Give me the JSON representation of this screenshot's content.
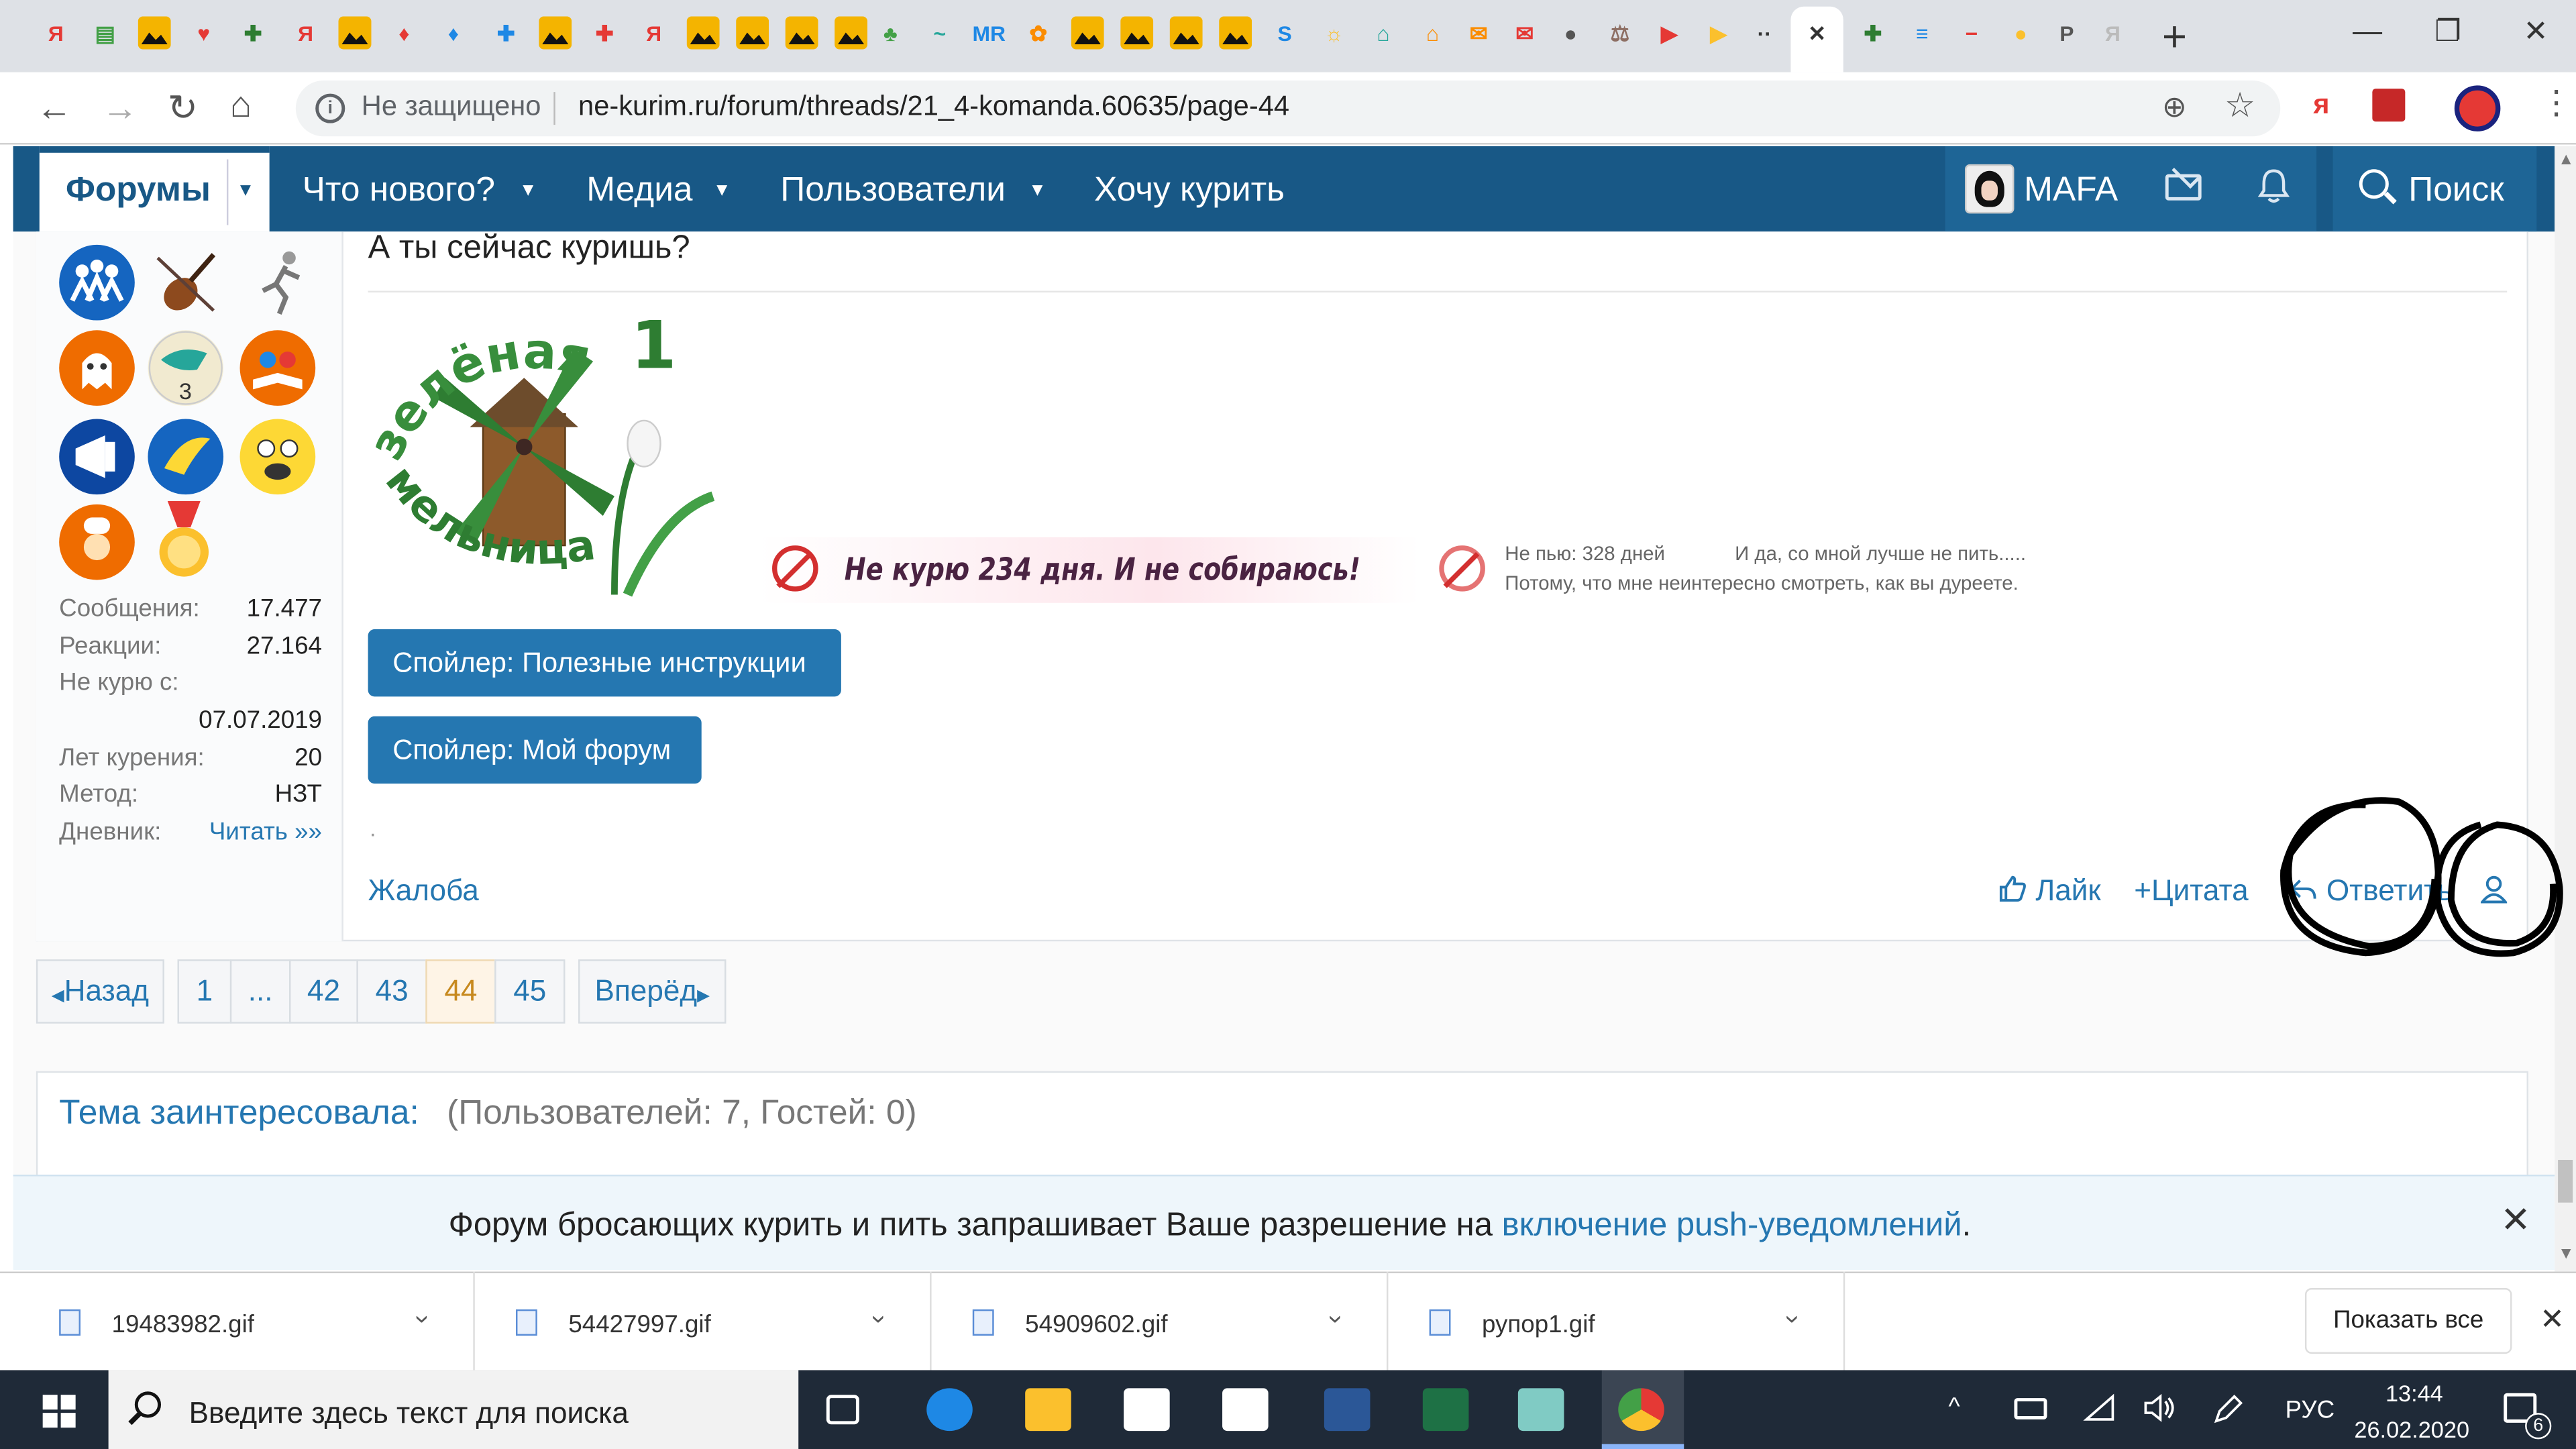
{
  "browser": {
    "tabs": [
      {
        "icon": "yandex-icon",
        "glyph": "Я",
        "color": "#e53935"
      },
      {
        "icon": "cart-icon",
        "glyph": "▤",
        "color": "#43a047"
      },
      {
        "icon": "image-icon",
        "glyph": "",
        "color": "#f4b400"
      },
      {
        "icon": "heart-icon",
        "glyph": "♥",
        "color": "#e53935"
      },
      {
        "icon": "plus-icon",
        "glyph": "✚",
        "color": "#2e7d32"
      },
      {
        "icon": "yandex-icon",
        "glyph": "Я",
        "color": "#e53935"
      },
      {
        "icon": "image-icon",
        "glyph": "",
        "color": "#f4b400"
      },
      {
        "icon": "map-pin-icon",
        "glyph": "♦",
        "color": "#e53935"
      },
      {
        "icon": "maps-icon",
        "glyph": "♦",
        "color": "#1e88e5"
      },
      {
        "icon": "cross-icon",
        "glyph": "✚",
        "color": "#1e88e5"
      },
      {
        "icon": "image-icon",
        "glyph": "",
        "color": "#f4b400"
      },
      {
        "icon": "medical-cross-icon",
        "glyph": "✚",
        "color": "#e53935"
      },
      {
        "icon": "yandex-icon",
        "glyph": "Я",
        "color": "#e53935"
      },
      {
        "icon": "image-icon",
        "glyph": "",
        "color": "#f4b400"
      },
      {
        "icon": "image-icon",
        "glyph": "",
        "color": "#f4b400"
      },
      {
        "icon": "image-icon",
        "glyph": "",
        "color": "#f4b400"
      },
      {
        "icon": "image-icon",
        "glyph": "",
        "color": "#f4b400"
      },
      {
        "icon": "flask-icon",
        "glyph": "♣",
        "color": "#43a047"
      },
      {
        "icon": "leaf-icon",
        "glyph": "~",
        "color": "#26a69a"
      },
      {
        "icon": "mr-icon",
        "glyph": "MR",
        "color": "#1e88e5"
      },
      {
        "icon": "flower-icon",
        "glyph": "✿",
        "color": "#fb8c00"
      },
      {
        "icon": "image-icon",
        "glyph": "",
        "color": "#f4b400"
      },
      {
        "icon": "image-icon",
        "glyph": "",
        "color": "#f4b400"
      },
      {
        "icon": "image-icon",
        "glyph": "",
        "color": "#f4b400"
      },
      {
        "icon": "image-icon",
        "glyph": "",
        "color": "#f4b400"
      },
      {
        "icon": "s-icon",
        "glyph": "S",
        "color": "#1e88e5"
      },
      {
        "icon": "sun-icon",
        "glyph": "☼",
        "color": "#fbc02d"
      },
      {
        "icon": "house-icon",
        "glyph": "⌂",
        "color": "#26a69a"
      },
      {
        "icon": "house-icon",
        "glyph": "⌂",
        "color": "#fb8c00"
      },
      {
        "icon": "mail-icon",
        "glyph": "✉",
        "color": "#fb8c00"
      },
      {
        "icon": "mail-icon",
        "glyph": "✉",
        "color": "#e53935"
      },
      {
        "icon": "globe-icon",
        "glyph": "●",
        "color": "#555555"
      },
      {
        "icon": "scales-icon",
        "glyph": "⚖",
        "color": "#8d6e63"
      },
      {
        "icon": "youtube-icon",
        "glyph": "▶",
        "color": "#e53935"
      },
      {
        "icon": "play-icon",
        "glyph": "▶",
        "color": "#fbc02d"
      },
      {
        "icon": "dots-icon",
        "glyph": "··",
        "color": "#333333"
      },
      {
        "icon": "close-icon",
        "glyph": "✕",
        "color": "#333333"
      },
      {
        "icon": "plus-icon",
        "glyph": "✚",
        "color": "#2e7d32"
      },
      {
        "icon": "docs-icon",
        "glyph": "≡",
        "color": "#1e88e5"
      },
      {
        "icon": "minus-circle-icon",
        "glyph": "−",
        "color": "#e53935"
      },
      {
        "icon": "pin-icon",
        "glyph": "●",
        "color": "#fbc02d"
      },
      {
        "icon": "p-icon",
        "glyph": "P",
        "color": "#555555"
      },
      {
        "icon": "yandex-icon",
        "glyph": "Я",
        "color": "#bbbbbb"
      }
    ],
    "new_tab": "+",
    "win_min": "—",
    "win_restore": "❐",
    "win_close": "✕",
    "back": "←",
    "forward": "→",
    "reload": "↻",
    "home": "⌂",
    "security_icon": "i",
    "security_text": "Не защищено",
    "url": "ne-kurim.ru/forum/threads/21_4-komanda.60635/page-44",
    "zoom_icon": "⊕",
    "star_icon": "☆",
    "ext_yandex": "я",
    "menu_icon": "⋮"
  },
  "forum_nav": {
    "forums": "Форумы",
    "caret": "▼",
    "items": [
      {
        "label": "Что нового?",
        "has_caret": true
      },
      {
        "label": "Медиа",
        "has_caret": true
      },
      {
        "label": "Пользователи",
        "has_caret": true
      },
      {
        "label": "Хочу курить",
        "has_caret": false
      }
    ],
    "username": "MAFA",
    "bell": "🔔",
    "search": "Поиск"
  },
  "post": {
    "question": "А ты сейчас куришь?",
    "stats": [
      {
        "key": "Сообщения:",
        "value": "17.477"
      },
      {
        "key": "Реакции:",
        "value": "27.164"
      },
      {
        "key": "Не курю с:",
        "value": ""
      },
      {
        "key": "",
        "value": "07.07.2019"
      },
      {
        "key": "Лет курения:",
        "value": "20"
      },
      {
        "key": "Метод:",
        "value": "НЗТ"
      },
      {
        "key": "Дневник:",
        "value": "Читать »»"
      }
    ],
    "signature": {
      "logo_arc_top": "зелёная",
      "logo_arc_bottom": "мельница",
      "logo_number": "1",
      "banner_smoke": "Не курю 234 дня. И не собираюсь!",
      "banner_drink_1": "Не пью: 328 дней",
      "banner_drink_2": "И да, со мной лучше не пить.....",
      "banner_drink_3": "Потому, что мне неинтересно смотреть, как вы дуреете."
    },
    "spoilers": [
      "Спойлер: Полезные инструкции",
      "Спойлер: Мой форум"
    ],
    "dot": ".",
    "complaint": "Жалоба",
    "actions": {
      "like": "Лайк",
      "quote": "Цитата",
      "reply": "Ответить"
    }
  },
  "pagination": {
    "prev": "Назад",
    "pages": [
      "1",
      "...",
      "42",
      "43",
      "44",
      "45"
    ],
    "current": "44",
    "next": "Вперёд"
  },
  "interested": {
    "title": "Тема заинтересовала:",
    "count": "(Пользователей: 7, Гостей: 0)"
  },
  "push_notice": {
    "text_before": "Форум бросающих курить и пить запрашивает Ваше разрешение на ",
    "link": "включение push-уведомлений",
    "text_after": ".",
    "close": "✕"
  },
  "downloads": {
    "items": [
      "19483982.gif",
      "54427997.gif",
      "54909602.gif",
      "рупор1.gif"
    ],
    "show_all": "Показать все",
    "close": "✕"
  },
  "taskbar": {
    "search_placeholder": "Введите здесь текст для поиска",
    "apps": [
      {
        "name": "task-view-icon",
        "color": "#ffffff"
      },
      {
        "name": "edge-icon",
        "color": "#1e88e5"
      },
      {
        "name": "file-explorer-icon",
        "color": "#fbc02d"
      },
      {
        "name": "store-icon",
        "color": "#ffffff"
      },
      {
        "name": "mail-app-icon",
        "color": "#ffffff"
      },
      {
        "name": "word-icon",
        "color": "#2b5797"
      },
      {
        "name": "excel-icon",
        "color": "#1e7145"
      },
      {
        "name": "paint-icon",
        "color": "#80cbc4"
      },
      {
        "name": "chrome-icon",
        "color": "#e53935"
      }
    ],
    "tray_caret": "^",
    "language": "РУС",
    "time": "13:44",
    "date": "26.02.2020",
    "notifications": "6"
  }
}
